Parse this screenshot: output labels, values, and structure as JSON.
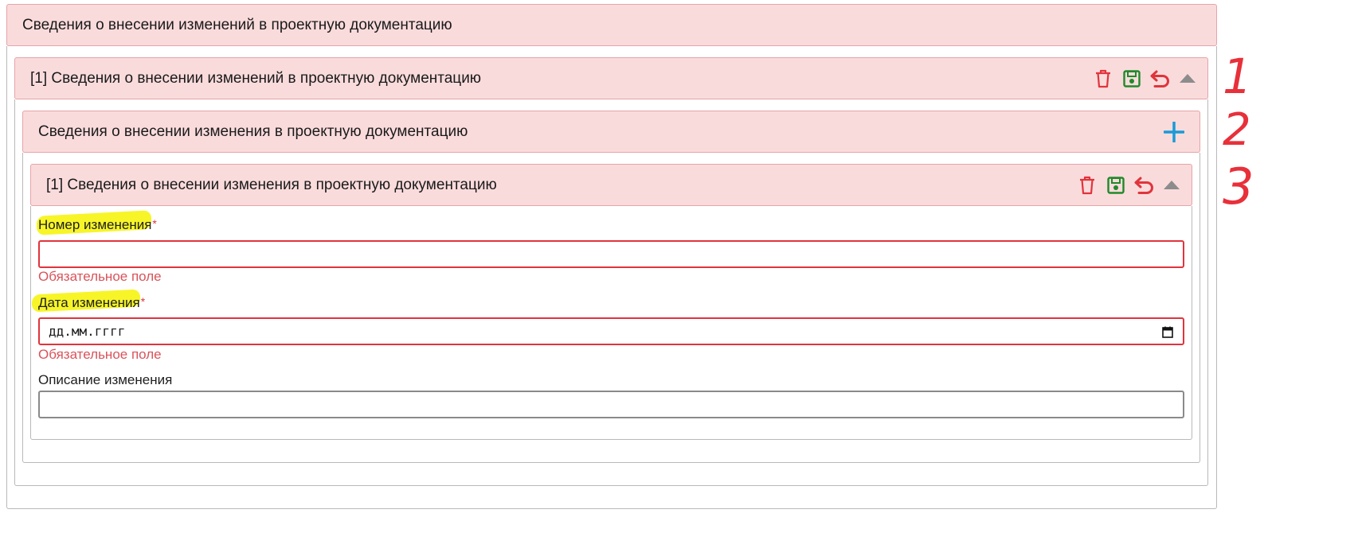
{
  "outer_panel": {
    "title": "Сведения о внесении изменений в проектную документацию"
  },
  "item1_panel": {
    "title": "[1] Сведения о внесении изменений в проектную документацию",
    "icons": [
      "trash-icon",
      "save-icon",
      "undo-icon",
      "collapse-up-icon"
    ]
  },
  "sub_panel": {
    "title": "Сведения о внесении изменения в проектную документацию",
    "icons": [
      "plus-icon"
    ]
  },
  "item2_panel": {
    "title": "[1] Сведения о внесении изменения в проектную документацию",
    "icons": [
      "trash-icon",
      "save-icon",
      "undo-icon",
      "collapse-up-icon"
    ]
  },
  "form": {
    "change_number": {
      "label": "Номер изменения",
      "required_mark": "*",
      "value": "",
      "error": "Обязательное поле"
    },
    "change_date": {
      "label": "Дата изменения",
      "required_mark": "*",
      "placeholder": "дд.мм.гггг",
      "error": "Обязательное поле"
    },
    "change_description": {
      "label": "Описание изменения",
      "value": ""
    }
  },
  "annotations": [
    "1",
    "2",
    "3"
  ],
  "colors": {
    "panel_bg": "#fadbdc",
    "panel_border": "#e6a4a8",
    "danger": "#e0343c",
    "success": "#1f8a2a",
    "info": "#1a9ad6",
    "highlight": "#f7f528"
  }
}
